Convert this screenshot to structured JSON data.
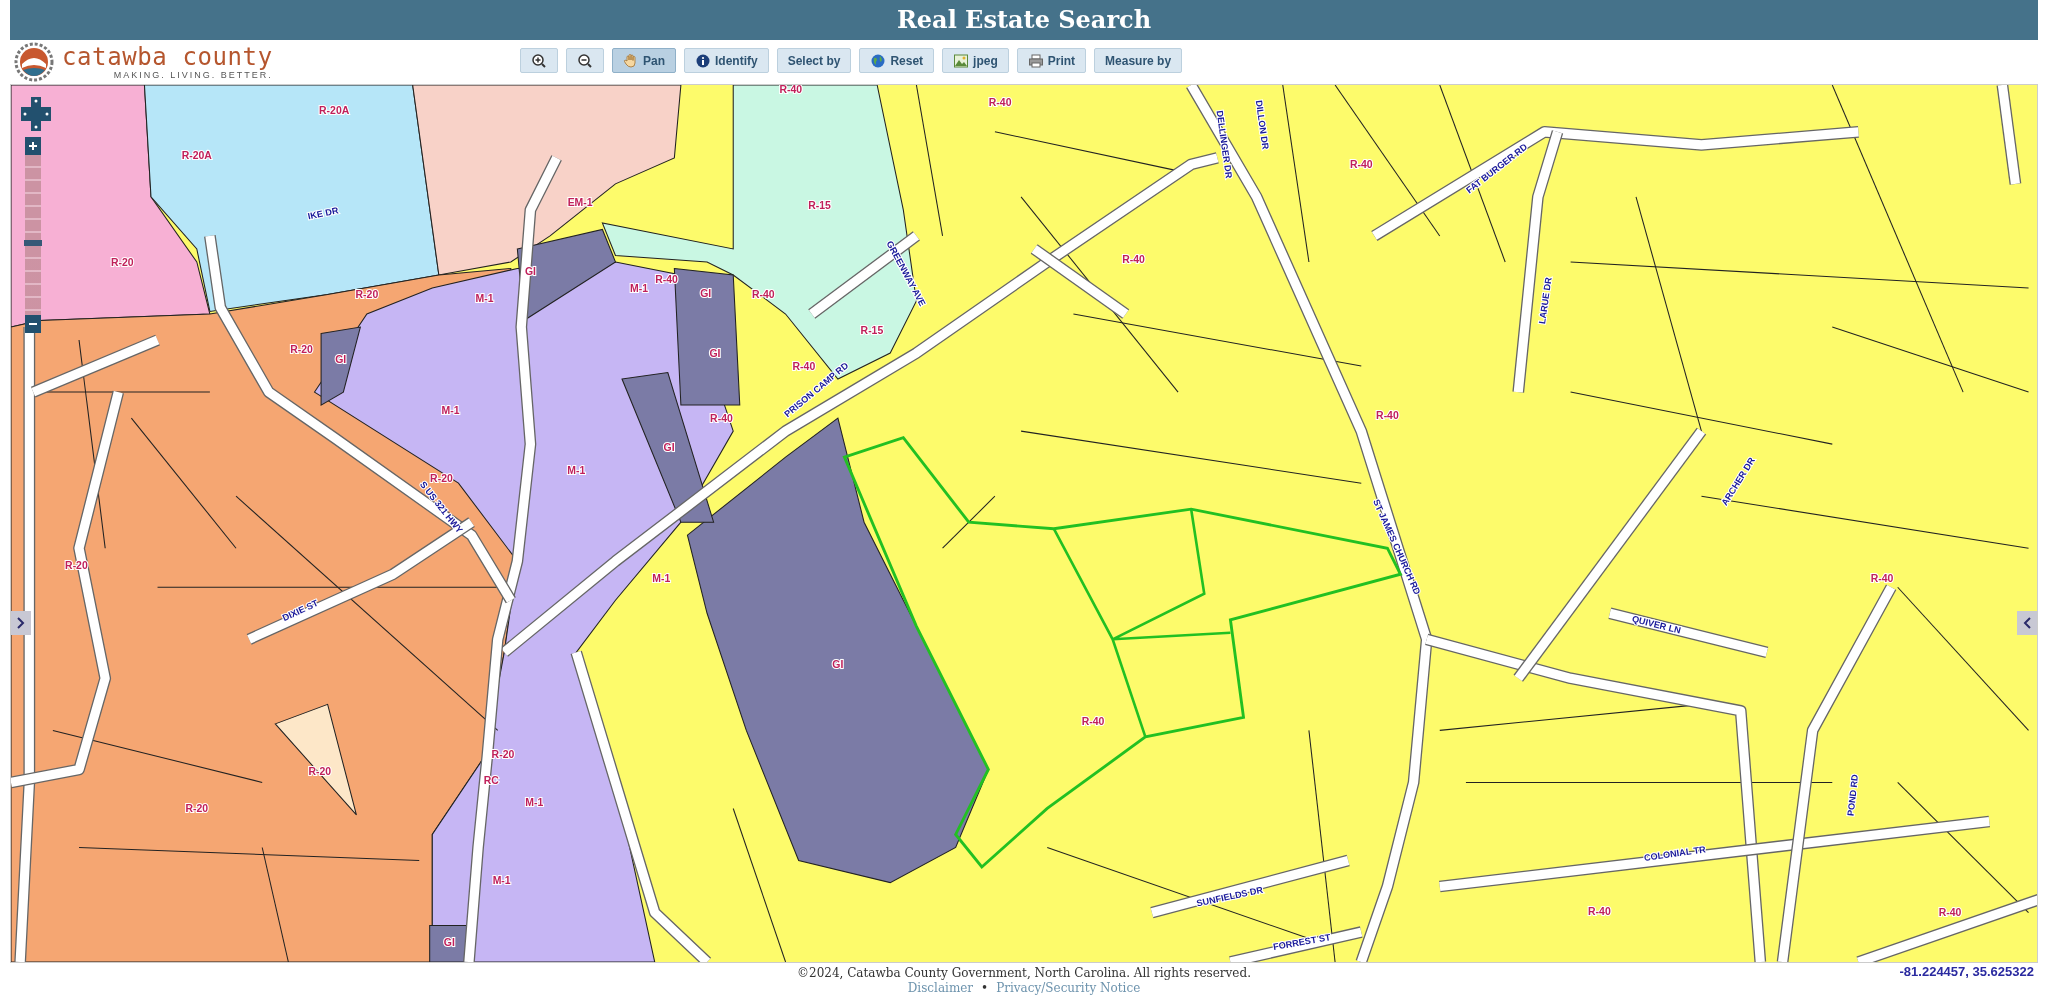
{
  "title_bar": {
    "title": "Real Estate Search"
  },
  "logo": {
    "name": "catawba county",
    "tagline": "MAKING. LIVING. BETTER."
  },
  "toolbar": [
    {
      "kind": "zoomin",
      "selected": false
    },
    {
      "kind": "zoomout",
      "selected": false
    },
    {
      "kind": "pan",
      "label": "Pan",
      "selected": true
    },
    {
      "kind": "identify",
      "label": "Identify",
      "selected": false
    },
    {
      "kind": "text",
      "label": "Select by",
      "selected": false
    },
    {
      "kind": "reset",
      "label": "Reset",
      "selected": false
    },
    {
      "kind": "jpeg",
      "label": "jpeg",
      "selected": false
    },
    {
      "kind": "print",
      "label": "Print",
      "selected": false
    },
    {
      "kind": "text",
      "label": "Measure by",
      "selected": false
    }
  ],
  "map": {
    "zoom_slider": {
      "level": 0.45
    },
    "zone_labels": [
      "R-20A",
      "R-20A",
      "R-20",
      "R-20",
      "R-20",
      "GI",
      "R-20",
      "R-20",
      "R-20",
      "R-20",
      "RC",
      "R-20",
      "M-1",
      "M-1",
      "M-1",
      "M-1",
      "M-1",
      "M-1",
      "M-1",
      "GI",
      "GI",
      "GI",
      "GI",
      "GI",
      "GI",
      "EM-1",
      "R-40",
      "R-15",
      "R-15",
      "R-40",
      "R-40",
      "R-40",
      "R-40",
      "R-40",
      "R-40",
      "R-40",
      "R-40",
      "R-40",
      "R-40",
      "R-40",
      "R-40"
    ],
    "road_labels": [
      "IKE DR",
      "PRISON CAMP RD",
      "GREENWAY AVE",
      "S US 321 HWY",
      "DIXIE ST",
      "DELLINGER DR",
      "DILLON DR",
      "FAT BURGER RD",
      "LARUE DR",
      "ST JAMES CHURCH RD",
      "ARCHER DR",
      "QUIVER LN",
      "COLONIAL TR",
      "POND RD",
      "SUNFIELDS DR",
      "FORREST ST"
    ],
    "coordinates": "-81.224457, 35.625322"
  },
  "footer": {
    "copyright": "©2024, Catawba County Government, North Carolina. All rights reserved.",
    "links": [
      "Disclaimer",
      "Privacy/Security Notice"
    ],
    "separator": "•"
  }
}
